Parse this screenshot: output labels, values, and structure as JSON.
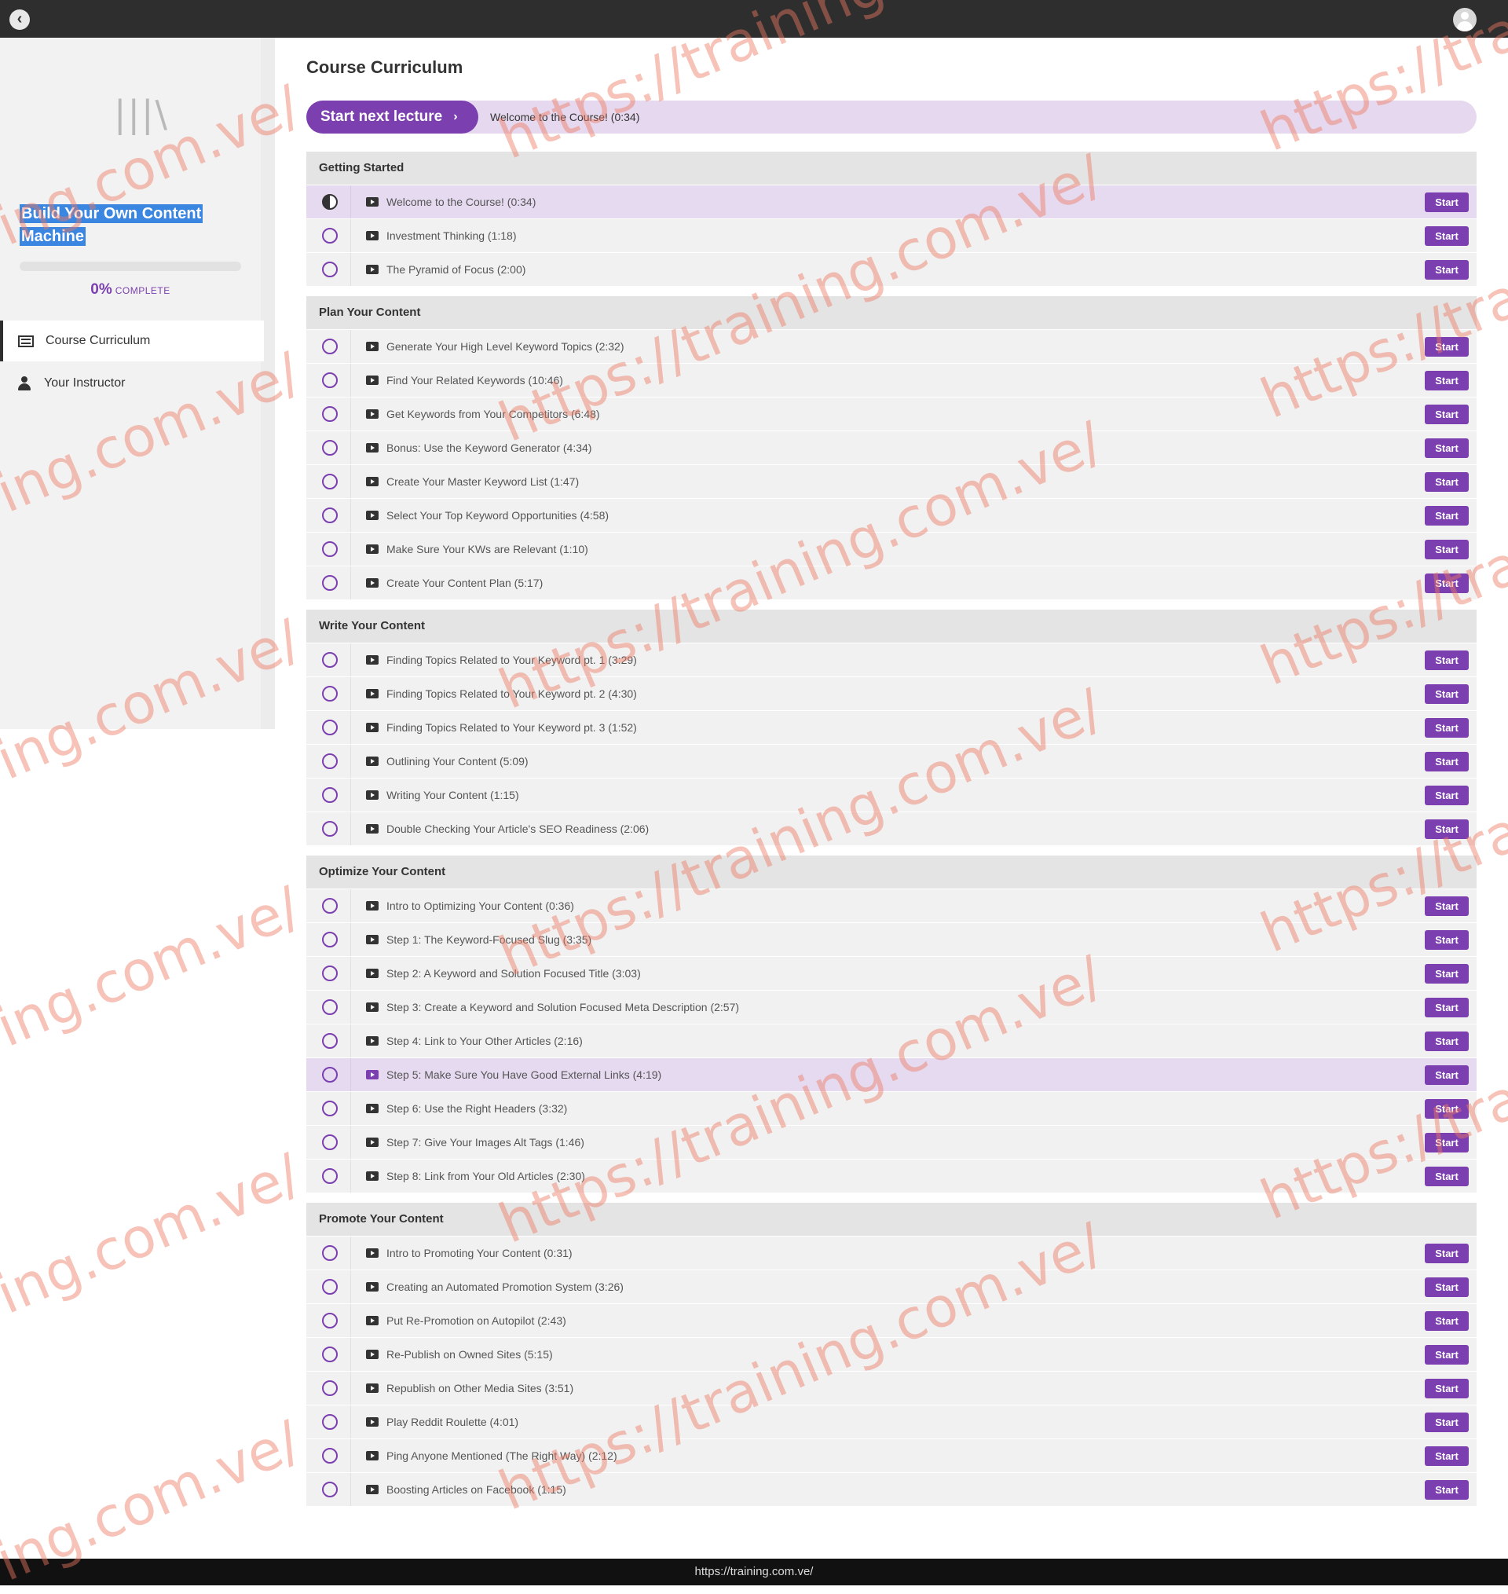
{
  "header": {
    "back_icon": "chevron-left-icon",
    "avatar_icon": "user-avatar-icon"
  },
  "sidebar": {
    "logo_text": "|||\\",
    "course_title": "Build Your Own Content Machine",
    "progress": {
      "percent": 0,
      "label_value": "0%",
      "label_word": "COMPLETE"
    },
    "nav": [
      {
        "label": "Course Curriculum",
        "icon": "list-icon",
        "active": true
      },
      {
        "label": "Your Instructor",
        "icon": "user-icon",
        "active": false
      }
    ]
  },
  "main": {
    "title": "Course Curriculum",
    "next_lecture": {
      "button_label": "Start next lecture",
      "button_icon": "chevron-right-icon",
      "lecture_title": "Welcome to the Course! (0:34)"
    },
    "start_label": "Start",
    "sections": [
      {
        "title": "Getting Started",
        "lectures": [
          {
            "title": "Welcome to the Course! (0:34)",
            "state": "in-progress",
            "highlight": true
          },
          {
            "title": "Investment Thinking (1:18)"
          },
          {
            "title": "The Pyramid of Focus (2:00)"
          }
        ]
      },
      {
        "title": "Plan Your Content",
        "lectures": [
          {
            "title": "Generate Your High Level Keyword Topics (2:32)"
          },
          {
            "title": "Find Your Related Keywords (10:46)"
          },
          {
            "title": "Get Keywords from Your Competitors (6:48)"
          },
          {
            "title": "Bonus: Use the Keyword Generator (4:34)"
          },
          {
            "title": "Create Your Master Keyword List (1:47)"
          },
          {
            "title": "Select Your Top Keyword Opportunities (4:58)"
          },
          {
            "title": "Make Sure Your KWs are Relevant (1:10)"
          },
          {
            "title": "Create Your Content Plan (5:17)"
          }
        ]
      },
      {
        "title": "Write Your Content",
        "lectures": [
          {
            "title": "Finding Topics Related to Your Keyword pt. 1 (3:29)"
          },
          {
            "title": "Finding Topics Related to Your Keyword pt. 2 (4:30)"
          },
          {
            "title": "Finding Topics Related to Your Keyword pt. 3 (1:52)"
          },
          {
            "title": "Outlining Your Content (5:09)"
          },
          {
            "title": "Writing Your Content (1:15)"
          },
          {
            "title": "Double Checking Your Article's SEO Readiness (2:06)"
          }
        ]
      },
      {
        "title": "Optimize Your Content",
        "lectures": [
          {
            "title": "Intro to Optimizing Your Content (0:36)"
          },
          {
            "title": "Step 1: The Keyword-Focused Slug (3:35)"
          },
          {
            "title": "Step 2: A Keyword and Solution Focused Title (3:03)"
          },
          {
            "title": "Step 3: Create a Keyword and Solution Focused Meta Description (2:57)"
          },
          {
            "title": "Step 4: Link to Your Other Articles (2:16)"
          },
          {
            "title": "Step 5: Make Sure You Have Good External Links (4:19)",
            "highlight": true,
            "hover": true
          },
          {
            "title": "Step 6: Use the Right Headers (3:32)"
          },
          {
            "title": "Step 7: Give Your Images Alt Tags (1:46)"
          },
          {
            "title": "Step 8: Link from Your Old Articles (2:30)"
          }
        ]
      },
      {
        "title": "Promote Your Content",
        "lectures": [
          {
            "title": "Intro to Promoting Your Content (0:31)"
          },
          {
            "title": "Creating an Automated Promotion System (3:26)"
          },
          {
            "title": "Put Re-Promotion on Autopilot (2:43)"
          },
          {
            "title": "Re-Publish on Owned Sites (5:15)"
          },
          {
            "title": "Republish on Other Media Sites (3:51)"
          },
          {
            "title": "Play Reddit Roulette (4:01)"
          },
          {
            "title": "Ping Anyone Mentioned (The Right Way) (2:12)"
          },
          {
            "title": "Boosting Articles on Facebook (1:15)"
          }
        ]
      }
    ]
  },
  "footer": {
    "url": "https://training.com.ve/"
  },
  "watermarks": [
    "https://training.com.ve/",
    "ing.com.ve/",
    "https://trai"
  ],
  "colors": {
    "accent": "#7b3fb0",
    "highlight_row": "#e6daf0",
    "topbar": "#2e2e2e",
    "title_selection": "#3a86e0"
  }
}
